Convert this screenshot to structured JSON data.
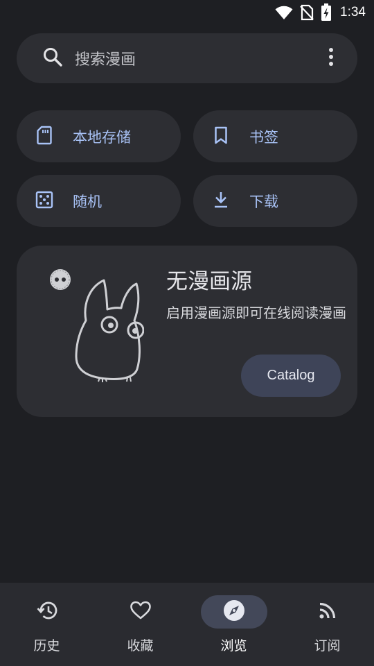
{
  "status_bar": {
    "time": "1:34",
    "icons": [
      "wifi-icon",
      "no-sim-icon",
      "battery-charging-icon"
    ]
  },
  "search": {
    "placeholder": "搜索漫画",
    "icon": "search-icon",
    "menu_icon": "more-vert-icon"
  },
  "quick_actions": [
    {
      "label": "本地存储",
      "icon": "sd-card-icon"
    },
    {
      "label": "书签",
      "icon": "bookmark-icon"
    },
    {
      "label": "随机",
      "icon": "dice-icon"
    },
    {
      "label": "下载",
      "icon": "download-icon"
    }
  ],
  "empty_state": {
    "title": "无漫画源",
    "description": "启用漫画源即可在线阅读漫画",
    "button_label": "Catalog",
    "illustration": "totoro-illustration"
  },
  "bottom_nav": {
    "items": [
      {
        "label": "历史",
        "icon": "history-icon",
        "active": false
      },
      {
        "label": "收藏",
        "icon": "heart-icon",
        "active": false
      },
      {
        "label": "浏览",
        "icon": "compass-icon",
        "active": true
      },
      {
        "label": "订阅",
        "icon": "rss-icon",
        "active": false
      }
    ]
  },
  "colors": {
    "background": "#1e1f23",
    "surface": "#2d2e33",
    "accent_text": "#a9c3f7",
    "active_pill": "#434859"
  }
}
